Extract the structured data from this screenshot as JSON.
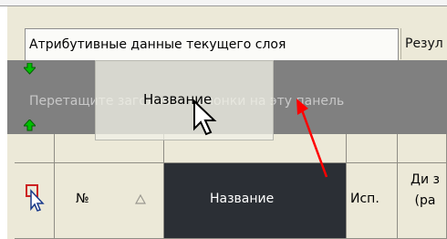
{
  "tabs": [
    {
      "label": "Атрибутивные данные текущего слоя",
      "active": true
    },
    {
      "label": "Резул",
      "active": false
    }
  ],
  "group_panel": {
    "hint": "Перетащите заголовок колонки на эту панель"
  },
  "drag_ghost": {
    "label": "Название"
  },
  "columns": [
    {
      "label": "",
      "icon": "select-cursor-icon"
    },
    {
      "label": "№",
      "sort": "up"
    },
    {
      "label": "Название",
      "selected": true
    },
    {
      "label": "Исп."
    },
    {
      "label": "Ди з (ра"
    }
  ],
  "colors": {
    "group_panel_bg": "#808080",
    "selected_header_bg": "#2b2f35",
    "annotation_arrow": "#ff0000",
    "move_arrow": "#00c000"
  }
}
